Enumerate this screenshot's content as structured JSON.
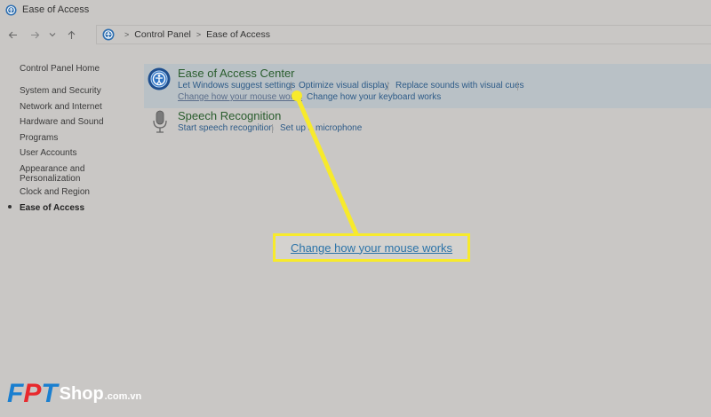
{
  "window": {
    "title": "Ease of Access"
  },
  "nav": {
    "back_icon": "arrow-left-icon",
    "forward_icon": "arrow-right-icon",
    "recent_icon": "chevron-down-icon",
    "up_icon": "arrow-up-icon"
  },
  "breadcrumb": {
    "root": "Control Panel",
    "current": "Ease of Access"
  },
  "sidebar": {
    "home": "Control Panel Home",
    "items": [
      {
        "label": "System and Security"
      },
      {
        "label": "Network and Internet"
      },
      {
        "label": "Hardware and Sound"
      },
      {
        "label": "Programs"
      },
      {
        "label": "User Accounts"
      },
      {
        "label": "Appearance and Personalization"
      },
      {
        "label": "Clock and Region"
      },
      {
        "label": "Ease of Access",
        "active": true
      }
    ]
  },
  "sections": [
    {
      "title": "Ease of Access Center",
      "icon": "ease-of-access-icon",
      "links": [
        "Let Windows suggest settings",
        "Optimize visual display",
        "Replace sounds with visual cues",
        "Change how your mouse works",
        "Change how your keyboard works"
      ]
    },
    {
      "title": "Speech Recognition",
      "icon": "microphone-icon",
      "links": [
        "Start speech recognition",
        "Set up a microphone"
      ]
    }
  ],
  "callout": {
    "text": "Change how your mouse works"
  },
  "brand": {
    "f": "F",
    "p": "P",
    "t": "T",
    "shop": "Shop",
    "domain": ".com.vn"
  },
  "colors": {
    "background": "#c9c7c5",
    "link": "#2d5b88",
    "section_title": "#2a5d2e",
    "callout_border": "#f7ea2c",
    "brand_blue": "#1a7fd0",
    "brand_red": "#e8292d"
  }
}
